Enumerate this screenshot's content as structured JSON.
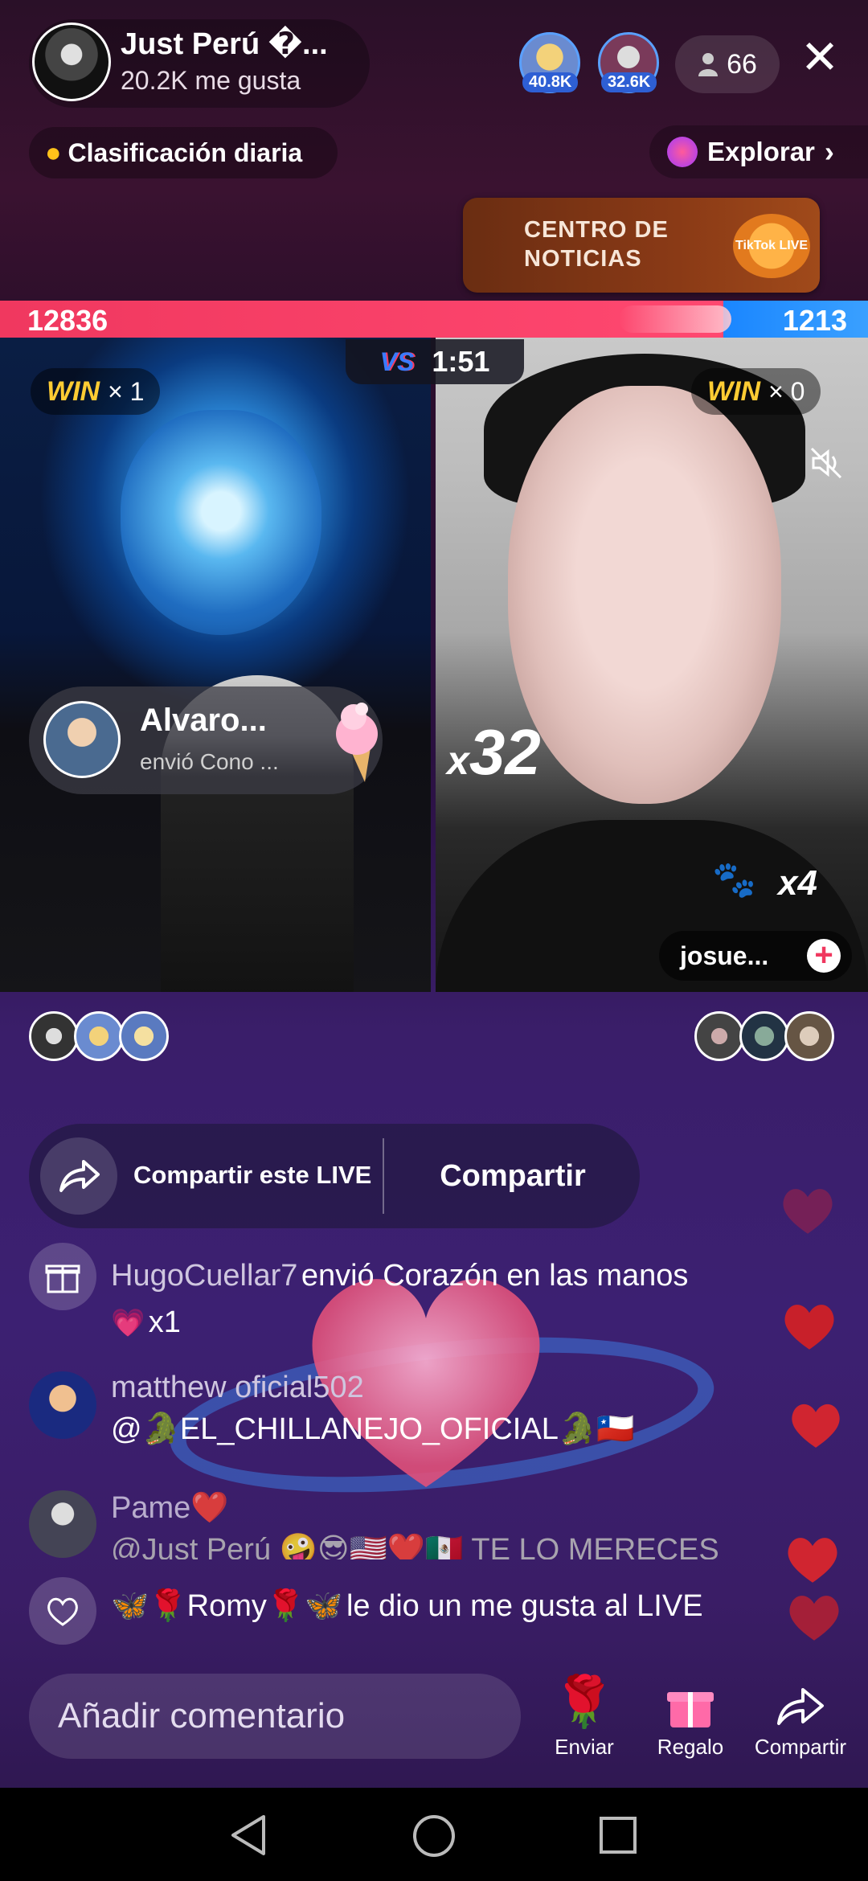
{
  "header": {
    "host_name": "Just Perú �...",
    "host_likes": "20.2K me gusta",
    "top_viewers": [
      {
        "badge": "40.8K"
      },
      {
        "badge": "32.6K"
      }
    ],
    "viewer_count": "66"
  },
  "ranking": {
    "label": "Clasificación diaria"
  },
  "explore": {
    "label": "Explorar"
  },
  "news_card": {
    "line1": "CENTRO DE",
    "line2": "NOTICIAS",
    "logo": "TikTok LIVE"
  },
  "battle": {
    "score_left": "12836",
    "score_right": "1213",
    "timer": "1:51",
    "vs_label": "VS",
    "left_win": {
      "word": "WIN",
      "count": "× 1"
    },
    "right_win": {
      "word": "WIN",
      "count": "× 0"
    },
    "gift_notification": {
      "name": "Alvaro...",
      "text": "envió Cono ..."
    },
    "multiplier_x": "x",
    "multiplier_value": "32",
    "combo": "x4",
    "opponent_name": "josue..."
  },
  "share": {
    "text": "Compartir este LIVE",
    "button": "Compartir"
  },
  "chat": [
    {
      "type": "gift",
      "user": "HugoCuellar7",
      "message": "envió Corazón en las manos",
      "count": "x1"
    },
    {
      "type": "comment",
      "user": "matthew oficial502",
      "message": "@🐊EL_CHILLANEJO_OFICIAL🐊🇨🇱"
    },
    {
      "type": "comment",
      "user": "Pame❤️",
      "message": "@Just Perú 🤪😎🇺🇸❤️🇲🇽 TE LO MERECES"
    },
    {
      "type": "like",
      "user": "🦋🌹Romy🌹🦋",
      "message": "le dio un me gusta al LIVE"
    }
  ],
  "bottom": {
    "comment_placeholder": "Añadir comentario",
    "send_label": "Enviar",
    "gift_label": "Regalo",
    "share_label": "Compartir"
  },
  "colors": {
    "red": "#f0385f",
    "blue": "#1a86ff",
    "win_gold": "#ffcc33"
  },
  "icons": [
    "close-icon",
    "person-icon",
    "fire-icon",
    "planet-icon",
    "chevron-right-icon",
    "mute-icon",
    "plus-icon",
    "share-icon",
    "gift-icon",
    "heart-icon",
    "rose-icon",
    "back-icon",
    "home-icon",
    "recents-icon"
  ]
}
